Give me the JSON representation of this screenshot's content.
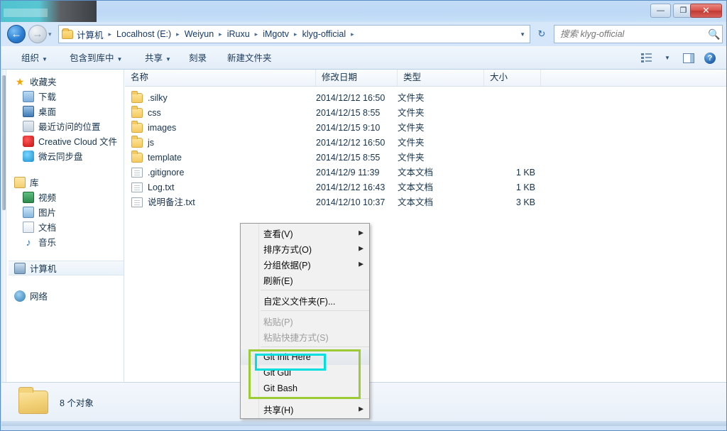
{
  "window": {
    "controls": {
      "minimize": "—",
      "maximize": "❐",
      "close": "✕"
    }
  },
  "address": {
    "back_arrow": "←",
    "forward_arrow": "→",
    "recent_caret": "▾",
    "dropdown_caret": "▼",
    "refresh_glyph": "↻",
    "crumbs": [
      "计算机",
      "Localhost (E:)",
      "Weiyun",
      "iRuxu",
      "iMgotv",
      "klyg-official"
    ],
    "separator": "▸"
  },
  "search": {
    "placeholder": "搜索 klyg-official",
    "icon": "search-icon",
    "glyph": "🔍"
  },
  "toolbar": {
    "items": [
      {
        "label": "组织",
        "has_caret": true
      },
      {
        "label": "包含到库中",
        "has_caret": true
      },
      {
        "label": "共享",
        "has_caret": true
      },
      {
        "label": "刻录",
        "has_caret": false
      },
      {
        "label": "新建文件夹",
        "has_caret": false
      }
    ],
    "caret": "▼",
    "view_caret": "▼",
    "help_glyph": "?"
  },
  "sidebar": {
    "groups": [
      {
        "title": "收藏夹",
        "icon": "star-icon",
        "items": [
          {
            "label": "下载",
            "icon": "download-icon"
          },
          {
            "label": "桌面",
            "icon": "desktop-icon"
          },
          {
            "label": "最近访问的位置",
            "icon": "recent-places-icon"
          },
          {
            "label": "Creative Cloud 文件",
            "icon": "creative-cloud-icon"
          },
          {
            "label": "微云同步盘",
            "icon": "weiyun-sync-icon"
          }
        ]
      },
      {
        "title": "库",
        "icon": "library-icon",
        "items": [
          {
            "label": "视频",
            "icon": "video-icon"
          },
          {
            "label": "图片",
            "icon": "picture-icon"
          },
          {
            "label": "文档",
            "icon": "document-icon"
          },
          {
            "label": "音乐",
            "icon": "music-icon"
          }
        ]
      }
    ],
    "standalone": [
      {
        "label": "计算机",
        "icon": "computer-icon",
        "selected": true
      },
      {
        "label": "网络",
        "icon": "network-icon",
        "selected": false
      }
    ],
    "star_glyph": "★",
    "music_glyph": "♪"
  },
  "filelist": {
    "columns": [
      {
        "key": "name",
        "label": "名称"
      },
      {
        "key": "date",
        "label": "修改日期"
      },
      {
        "key": "type",
        "label": "类型"
      },
      {
        "key": "size",
        "label": "大小"
      }
    ],
    "rows": [
      {
        "name": ".silky",
        "date": "2014/12/12 16:50",
        "type": "文件夹",
        "size": "",
        "icon": "folder-icon"
      },
      {
        "name": "css",
        "date": "2014/12/15 8:55",
        "type": "文件夹",
        "size": "",
        "icon": "folder-icon"
      },
      {
        "name": "images",
        "date": "2014/12/15 9:10",
        "type": "文件夹",
        "size": "",
        "icon": "folder-icon"
      },
      {
        "name": "js",
        "date": "2014/12/12 16:50",
        "type": "文件夹",
        "size": "",
        "icon": "folder-icon"
      },
      {
        "name": "template",
        "date": "2014/12/15 8:55",
        "type": "文件夹",
        "size": "",
        "icon": "folder-icon"
      },
      {
        "name": ".gitignore",
        "date": "2014/12/9 11:39",
        "type": "文本文档",
        "size": "1 KB",
        "icon": "document-icon"
      },
      {
        "name": "Log.txt",
        "date": "2014/12/12 16:43",
        "type": "文本文档",
        "size": "1 KB",
        "icon": "document-icon"
      },
      {
        "name": "说明备注.txt",
        "date": "2014/12/10 10:37",
        "type": "文本文档",
        "size": "3 KB",
        "icon": "document-icon"
      }
    ]
  },
  "status": {
    "text": "8 个对象",
    "icon": "folder-icon"
  },
  "context_menu": {
    "items": [
      {
        "label": "查看(V)",
        "submenu": true,
        "disabled": false,
        "separator_after": false
      },
      {
        "label": "排序方式(O)",
        "submenu": true,
        "disabled": false,
        "separator_after": false
      },
      {
        "label": "分组依据(P)",
        "submenu": true,
        "disabled": false,
        "separator_after": false
      },
      {
        "label": "刷新(E)",
        "submenu": false,
        "disabled": false,
        "separator_after": true
      },
      {
        "label": "自定义文件夹(F)...",
        "submenu": false,
        "disabled": false,
        "separator_after": true
      },
      {
        "label": "粘贴(P)",
        "submenu": false,
        "disabled": true,
        "separator_after": false
      },
      {
        "label": "粘贴快捷方式(S)",
        "submenu": false,
        "disabled": true,
        "separator_after": true
      },
      {
        "label": "Git Init Here",
        "submenu": false,
        "disabled": false,
        "separator_after": false,
        "highlighted": true
      },
      {
        "label": "Git Gui",
        "submenu": false,
        "disabled": false,
        "separator_after": false
      },
      {
        "label": "Git Bash",
        "submenu": false,
        "disabled": false,
        "separator_after": true
      },
      {
        "label": "共享(H)",
        "submenu": true,
        "disabled": false,
        "separator_after": false
      }
    ],
    "submenu_arrow": "▶"
  },
  "annotations": {
    "group_box_color": "#9ccb35",
    "highlight_box_color": "#00dede"
  }
}
